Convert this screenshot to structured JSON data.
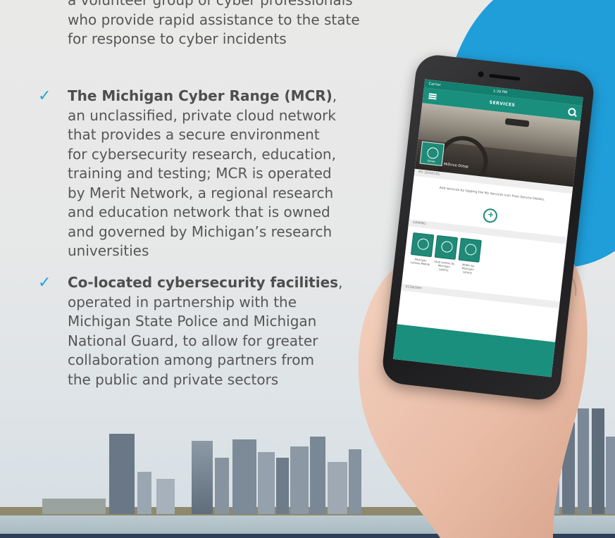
{
  "colors": {
    "accent_blue": "#1f9ed9",
    "checkmark": "#1da3dc",
    "app_teal": "#1a8f7d",
    "body_text": "#565656"
  },
  "intro": {
    "lines": [
      "a volunteer group of cyber professionals",
      "who provide rapid assistance to the state",
      "for response to cyber incidents"
    ]
  },
  "bullets": [
    {
      "check_icon": "checkmark-icon",
      "title": "The Michigan Cyber Range (MCR)",
      "title_suffix": ",",
      "lines": [
        "an unclassified, private cloud network",
        "that provides a secure environment",
        "for cybersecurity research, education,",
        "training and testing; MCR is operated",
        "by Merit Network, a regional research",
        "and education network that is owned",
        "and governed by Michigan’s research",
        "universities"
      ]
    },
    {
      "check_icon": "checkmark-icon",
      "title": "Co-located cybersecurity facilities",
      "title_suffix": ",",
      "lines": [
        "operated in partnership with the",
        "Michigan State Police and Michigan",
        "National Guard, to allow for greater",
        "collaboration among partners from",
        "the public and private sectors"
      ]
    }
  ],
  "phone_app": {
    "status_left": "Carrier",
    "status_time": "1:39 PM",
    "title": "SERVICES",
    "hero_tile_label": "Drive",
    "hero_caption": "MiDrive Dstop",
    "section_my_services": "MY SERVICES",
    "my_services_message": "Add services by tapping the My Services icon from Service Details.",
    "section_gaming": "GAMING",
    "gaming_tiles": [
      {
        "caption": "Michigan Lottery Mobile"
      },
      {
        "caption": "Club Lottery by Michigan Lottery"
      },
      {
        "caption": "MiWin by Michigan Lottery"
      }
    ],
    "section_economy": "ECONOMY"
  }
}
